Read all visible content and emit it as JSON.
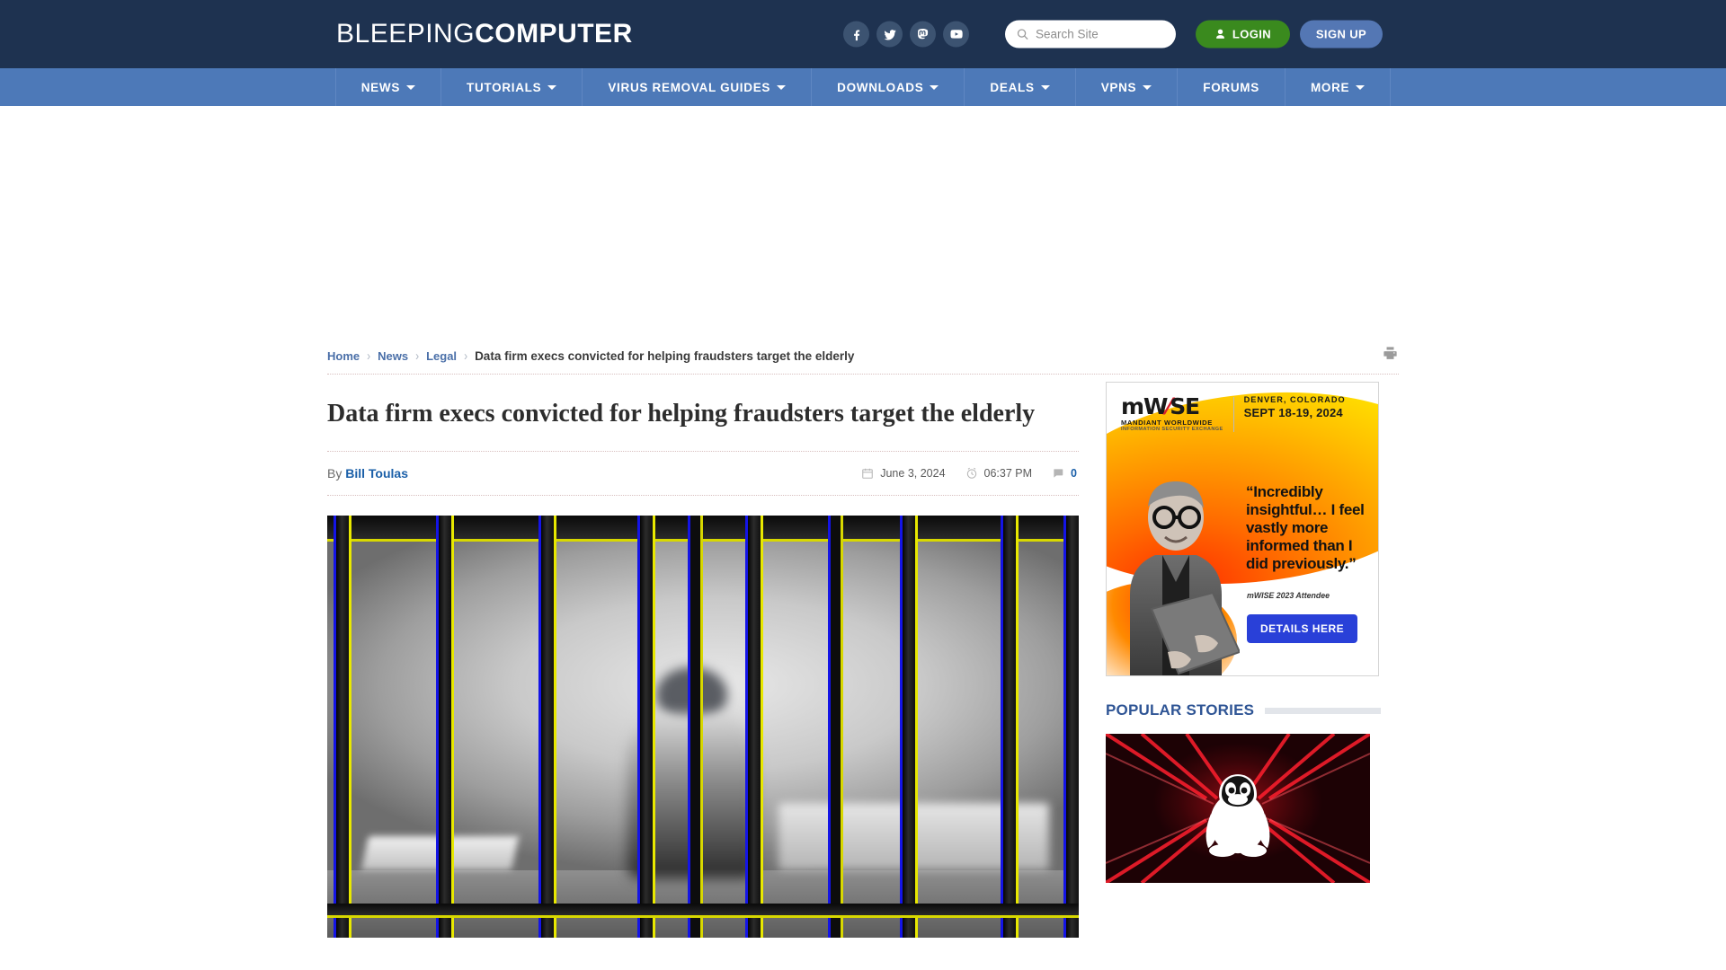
{
  "site": {
    "logo_thin": "BLEEPING",
    "logo_bold": "COMPUTER",
    "header_bg": "#1e3250",
    "nav_bg": "#4d79b8"
  },
  "header": {
    "social": [
      {
        "name": "facebook-icon",
        "label": "Facebook"
      },
      {
        "name": "twitter-icon",
        "label": "Twitter"
      },
      {
        "name": "mastodon-icon",
        "label": "Mastodon"
      },
      {
        "name": "youtube-icon",
        "label": "YouTube"
      }
    ],
    "search": {
      "placeholder": "Search Site",
      "value": ""
    },
    "login_label": "LOGIN",
    "signup_label": "SIGN UP",
    "login_color": "#3a8a1e",
    "signup_color": "#5477b4"
  },
  "nav": {
    "items": [
      {
        "label": "NEWS",
        "has_caret": true
      },
      {
        "label": "TUTORIALS",
        "has_caret": true
      },
      {
        "label": "VIRUS REMOVAL GUIDES",
        "has_caret": true
      },
      {
        "label": "DOWNLOADS",
        "has_caret": true
      },
      {
        "label": "DEALS",
        "has_caret": true
      },
      {
        "label": "VPNS",
        "has_caret": true
      },
      {
        "label": "FORUMS",
        "has_caret": false
      },
      {
        "label": "MORE",
        "has_caret": true
      }
    ]
  },
  "breadcrumb": {
    "links": [
      "Home",
      "News",
      "Legal"
    ],
    "separator": "›",
    "current": "Data firm execs convicted for helping fraudsters target the elderly"
  },
  "article": {
    "title": "Data firm execs convicted for helping fraudsters target the elderly",
    "by_prefix": "By",
    "author": "Bill Toulas",
    "date": "June 3, 2024",
    "time": "06:37 PM",
    "comments": "0"
  },
  "sidebar": {
    "ad": {
      "brand_m": "m",
      "brand_w": "W",
      "brand_slash": "⁄",
      "brand_ise": "SE",
      "brand_sub1": "MANDIANT WORLDWIDE",
      "brand_sub2": "INFORMATION SECURITY EXCHANGE",
      "location": "DENVER, COLORADO",
      "dates": "SEPT 18-19, 2024",
      "quote": "“Incredibly insightful… I feel vastly more informed than I did previously.”",
      "attribution": "mWISE 2023 Attendee",
      "cta": "DETAILS HERE",
      "cta_color": "#2940d8"
    },
    "popular_title": "POPULAR STORIES",
    "popular_title_color": "#2f5595"
  }
}
